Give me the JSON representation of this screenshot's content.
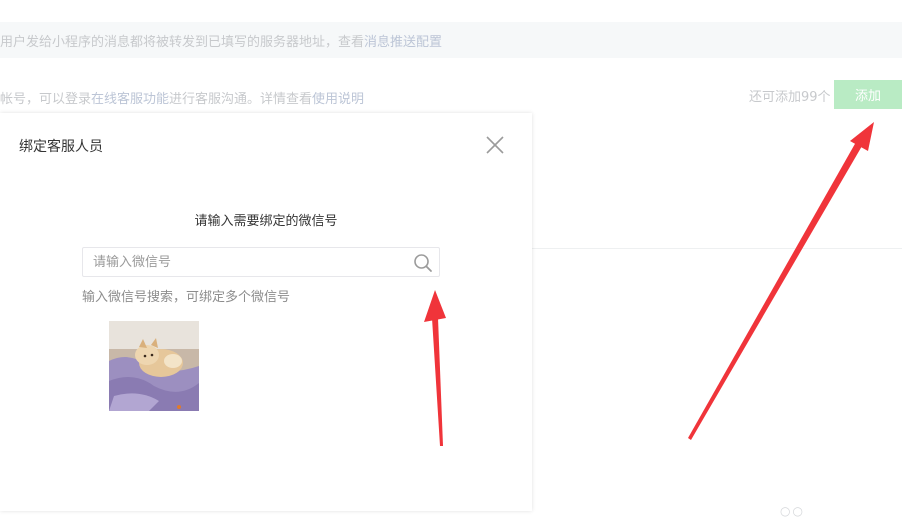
{
  "background": {
    "notice_text": "用户发给小程序的消息都将被转发到已填写的服务器地址，查看",
    "notice_link": "消息推送配置",
    "info_text_1": "帐号，可以登录",
    "info_link_1": "在线客服功能",
    "info_text_2": "进行客服沟通。详情查看",
    "info_link_2": "使用说明",
    "remaining_text": "还可添加99个",
    "add_button_label": "添加"
  },
  "dialog": {
    "title": "绑定客服人员",
    "prompt": "请输入需要绑定的微信号",
    "search_placeholder": "请输入微信号",
    "search_value": "",
    "hint": "输入微信号搜索，可绑定多个微信号"
  },
  "icons": [
    "close-icon",
    "search-icon"
  ],
  "colors": {
    "add_button_bg": "#b9ebc4",
    "annotation_arrow": "#f0343a",
    "link": "#bcc5d6"
  }
}
